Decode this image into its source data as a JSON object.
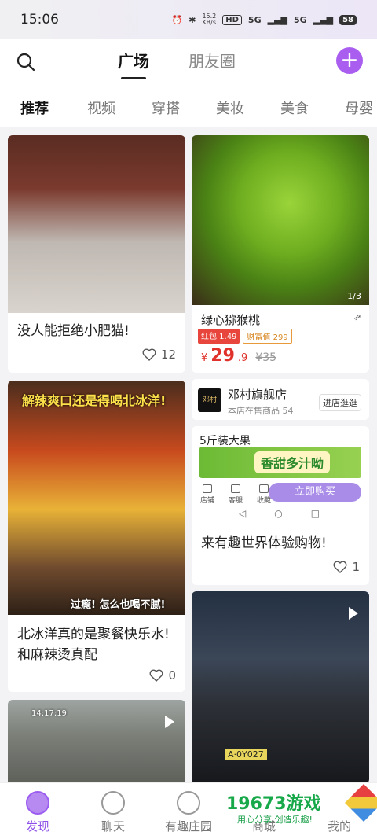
{
  "status": {
    "time": "15:06",
    "speed": "15.2\nKB/s",
    "hd": "HD",
    "net1": "5G",
    "net2": "5G",
    "battery": "58"
  },
  "header": {
    "tabs": [
      "广场",
      "朋友圈"
    ],
    "active_tab": "广场"
  },
  "categories": [
    "推荐",
    "视频",
    "穿搭",
    "美妆",
    "美食",
    "母婴"
  ],
  "feed": {
    "cat_post": {
      "title": "没人能拒绝小肥猫!",
      "likes": "12"
    },
    "kiwi_product": {
      "page_indicator": "1/3",
      "name": "绿心猕猴桃",
      "badge_red": "红包 1.49",
      "badge_wealth": "财富值 299",
      "price_currency": "¥",
      "price_int": "29",
      "price_dec": ".9",
      "price_old": "¥35"
    },
    "drink_post": {
      "overlay_top": "解辣爽口还是得喝北冰洋!",
      "overlay_bottom": "过瘾! 怎么也喝不腻!",
      "title_line1": "北冰洋真的是聚餐快乐水!",
      "title_line2": "和麻辣烫真配",
      "likes": "0"
    },
    "shop": {
      "logo": "邓村",
      "name": "邓村旗舰店",
      "sub": "本店在售商品 54",
      "button": "进店逛逛"
    },
    "promo": {
      "title": "5斤装大果",
      "banner": "香甜多汁呦",
      "tools": [
        "店铺",
        "客服",
        "收藏"
      ],
      "buy_button": "立即购买",
      "nav_keys": [
        "◁",
        "○",
        "□"
      ],
      "caption": "来有趣世界体验购物!",
      "likes": "1"
    },
    "street_post": {
      "timestamp": "14:17:19"
    },
    "night_post": {
      "plate": "A·0Y027"
    }
  },
  "bottom_nav": [
    {
      "label": "发现",
      "icon": "discover-icon",
      "active": true
    },
    {
      "label": "聊天",
      "icon": "chat-icon",
      "active": false
    },
    {
      "label": "有趣庄园",
      "icon": "planet-icon",
      "active": false
    },
    {
      "label": "商城",
      "icon": "shop-icon",
      "active": false
    },
    {
      "label": "我的",
      "icon": "profile-icon",
      "active": false
    }
  ],
  "watermark": {
    "brand": "19673游戏",
    "slogan": "用心分享,创造乐趣!"
  },
  "colors": {
    "accent": "#a95ef0",
    "price": "#e0322b",
    "page_bg": "#f3f3f5"
  }
}
